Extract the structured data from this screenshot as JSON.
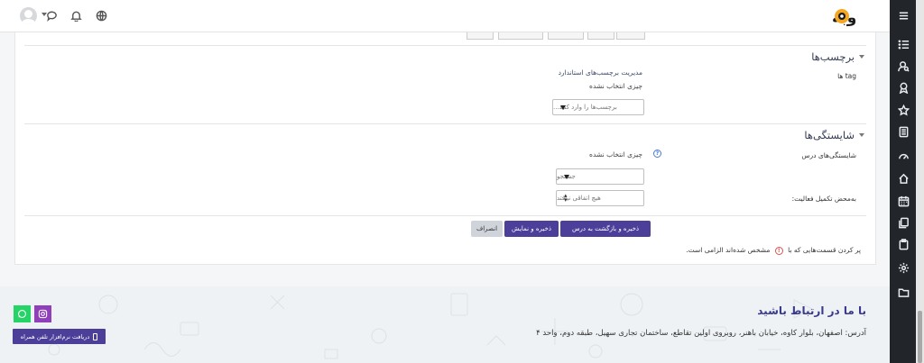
{
  "brand": {
    "logo_text": "وبه"
  },
  "tags": {
    "title": "برچسب‌ها",
    "field_label": "tag ها",
    "manage_link": "مدیریت برچسب‌های استاندارد",
    "selection": "چیزی انتخاب نشده",
    "input_placeholder": "برچسب‌ها را وارد کنید..."
  },
  "competencies": {
    "title": "شایستگی‌ها",
    "field_label": "شایستگی‌های درس",
    "selection": "چیزی انتخاب نشده",
    "search_placeholder": "جستجو",
    "on_completion_label": "به‌محض تکمیل فعالیت:",
    "on_completion_value": "هیچ اتفاقی نیافتد"
  },
  "actions": {
    "save_return": "ذخیره و بازگشت به درس",
    "save_display": "ذخیره و نمایش",
    "cancel": "انصراف"
  },
  "required_note": {
    "before": "پر کردن قسمت‌هایی که با",
    "after": "مشخص شده‌اند الزامی است."
  },
  "footer": {
    "title": "با ما در ارتباط باشید",
    "address": "آدرس: اصفهان، بلوار کاوه، خیابان باهنر، روبروی اولین تقاطع، ساختمان تجاری سهیل، طبقه دوم، واحد ۴",
    "app_button": "دریافت نرم‌افزار تلفن همراه"
  },
  "icons": {
    "rail": [
      "menu-icon",
      "list-icon",
      "user-search-icon",
      "award-icon",
      "star-icon",
      "book-icon",
      "dashboard-icon",
      "home-icon",
      "calendar-icon",
      "files-icon",
      "clipboard-icon",
      "gear-icon",
      "folder-icon"
    ],
    "topbar": [
      "globe-icon",
      "bell-icon",
      "chat-icon",
      "avatar",
      "chevron-down-icon"
    ]
  },
  "colors": {
    "primary": "#4b3f99",
    "rail": "#22262b",
    "required": "#d9534f",
    "whatsapp": "#25d366",
    "instagram": "#8e3fb9",
    "logo_accent": "#f5a623"
  }
}
